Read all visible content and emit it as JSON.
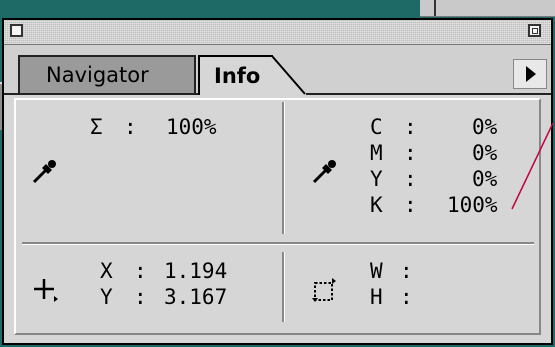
{
  "window": {
    "title": ""
  },
  "tabs": [
    {
      "label": "Navigator",
      "active": false
    },
    {
      "label": "Info",
      "active": true
    }
  ],
  "gray_readout": {
    "symbol": "Σ",
    "colon": ":",
    "value": "100%"
  },
  "cmyk_readout": [
    {
      "label": "C",
      "colon": ":",
      "value": "0%"
    },
    {
      "label": "M",
      "colon": ":",
      "value": "0%"
    },
    {
      "label": "Y",
      "colon": ":",
      "value": "0%"
    },
    {
      "label": "K",
      "colon": ":",
      "value": "100%"
    }
  ],
  "position_readout": [
    {
      "label": "X",
      "colon": ":",
      "value": "1.194"
    },
    {
      "label": "Y",
      "colon": ":",
      "value": "3.167"
    }
  ],
  "size_readout": [
    {
      "label": "W",
      "colon": ":",
      "value": ""
    },
    {
      "label": "H",
      "colon": ":",
      "value": ""
    }
  ],
  "icons": {
    "gray_eyedropper": "eyedropper-icon",
    "cmyk_eyedropper": "eyedropper-icon",
    "position": "crosshair-icon",
    "size": "marquee-icon",
    "menu": "triangle-right-icon"
  },
  "colors": {
    "panel": "#d6d6d6",
    "desktop": "#1e6a66",
    "cursor_line": "#c0003c"
  }
}
